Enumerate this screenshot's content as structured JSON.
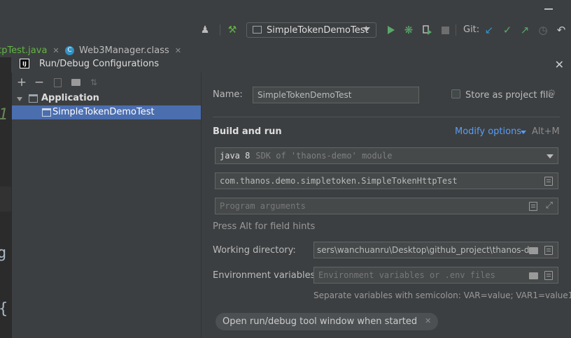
{
  "toolbar": {
    "run_config": "SimpleTokenDemoTest",
    "git_label": "Git:"
  },
  "tabs": [
    {
      "label": "ttpTest.java"
    },
    {
      "label": "Web3Manager.class"
    }
  ],
  "editor": {
    "fragments": [
      "1",
      "g",
      "{"
    ]
  },
  "dialog": {
    "title": "Run/Debug Configurations",
    "tree": {
      "group": "Application",
      "item": "SimpleTokenDemoTest"
    },
    "form": {
      "name_label": "Name:",
      "name_value": "SimpleTokenDemoTest",
      "store_label": "Store as project file",
      "section_build": "Build and run",
      "modify_options": "Modify options",
      "modify_shortcut": "Alt+M",
      "sdk_java": "java 8",
      "sdk_detail": "SDK of 'thaons-demo' module",
      "main_class": "com.thanos.demo.simpletoken.SimpleTokenHttpTest",
      "program_args_placeholder": "Program arguments",
      "hint": "Press Alt for field hints",
      "working_dir_label": "Working directory:",
      "working_dir_value": "sers\\wanchuanru\\Desktop\\github_project\\thanos-de",
      "env_label": "Environment variables:",
      "env_placeholder": "Environment variables or .env files",
      "env_hint": "Separate variables with semicolon: VAR=value; VAR1=value1",
      "open_tool_window": "Open run/debug tool window when started"
    }
  }
}
